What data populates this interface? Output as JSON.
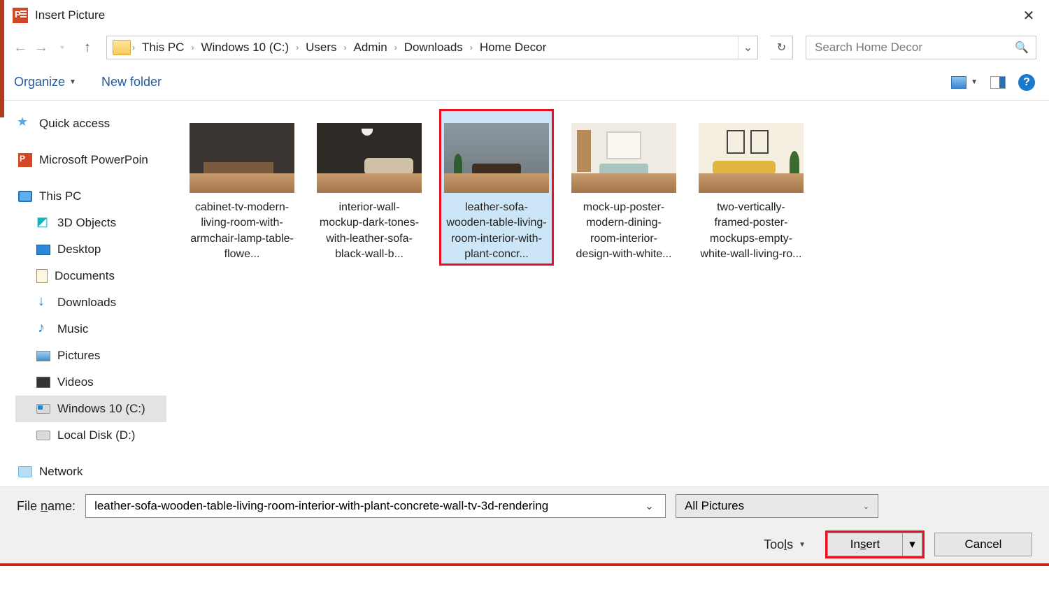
{
  "title": "Insert Picture",
  "breadcrumb": [
    "This PC",
    "Windows 10 (C:)",
    "Users",
    "Admin",
    "Downloads",
    "Home Decor"
  ],
  "search_placeholder": "Search Home Decor",
  "toolbar": {
    "organize": "Organize",
    "new_folder": "New folder"
  },
  "sidebar": {
    "quick_access": "Quick access",
    "powerpoint": "Microsoft PowerPoin",
    "this_pc": "This PC",
    "items": [
      "3D Objects",
      "Desktop",
      "Documents",
      "Downloads",
      "Music",
      "Pictures",
      "Videos",
      "Windows 10 (C:)",
      "Local Disk (D:)"
    ],
    "network": "Network"
  },
  "files": [
    {
      "name": "cabinet-tv-modern-living-room-with-armchair-lamp-table-flowe..."
    },
    {
      "name": "interior-wall-mockup-dark-tones-with-leather-sofa-black-wall-b..."
    },
    {
      "name": "leather-sofa-wooden-table-living-room-interior-with-plant-concr...",
      "selected": true
    },
    {
      "name": "mock-up-poster-modern-dining-room-interior-design-with-white..."
    },
    {
      "name": "two-vertically-framed-poster-mockups-empty-white-wall-living-ro..."
    }
  ],
  "footer": {
    "file_name_label_pre": "File ",
    "file_name_label_u": "n",
    "file_name_label_post": "ame:",
    "file_name_value": "leather-sofa-wooden-table-living-room-interior-with-plant-concrete-wall-tv-3d-rendering",
    "filter": "All Pictures",
    "tools_pre": "Too",
    "tools_u": "l",
    "tools_post": "s",
    "insert_pre": "In",
    "insert_u": "s",
    "insert_post": "ert",
    "cancel": "Cancel"
  }
}
